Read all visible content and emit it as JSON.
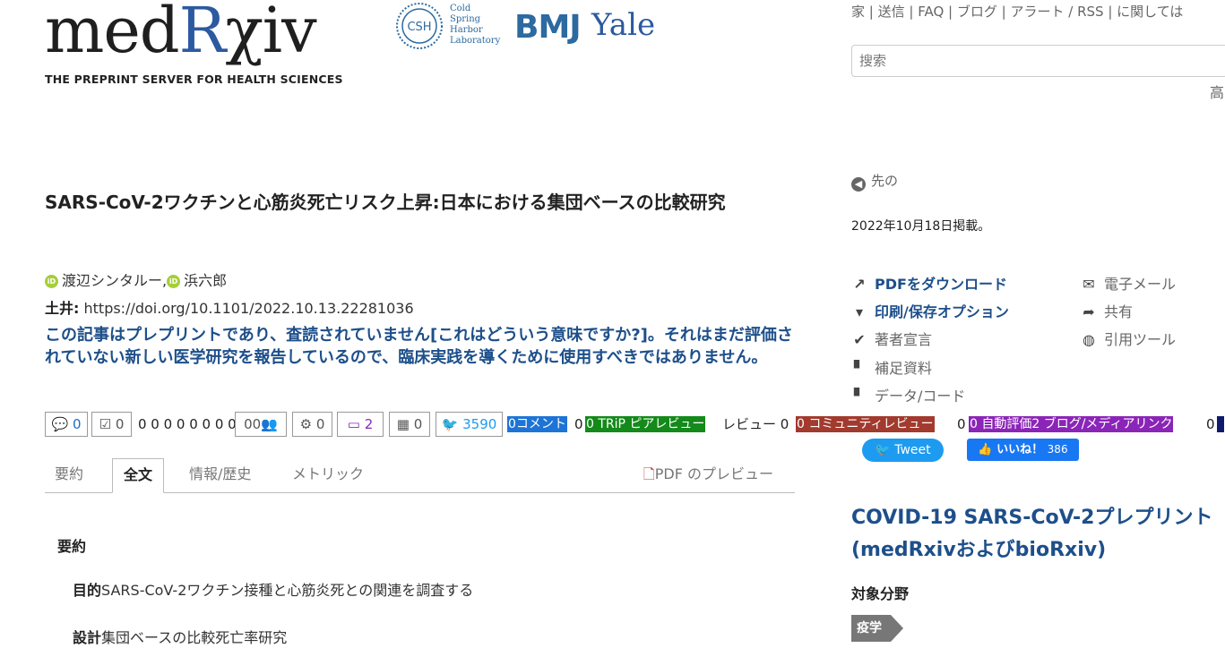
{
  "header": {
    "logo_main": "med",
    "logo_r": "R",
    "logo_rest": "χiv",
    "tagline": "THE PREPRINT SERVER FOR HEALTH SCIENCES",
    "csh_label": "CSH",
    "csh_text": [
      "Cold",
      "Spring",
      "Harbor",
      "Laboratory"
    ],
    "bmj": "BMJ",
    "yale": "Yale",
    "nav": [
      "家",
      "送信",
      "FAQ",
      "ブログ",
      "アラート / RSS",
      "に関しては"
    ],
    "search_placeholder": "搜索",
    "advanced": "高"
  },
  "article": {
    "title": "SARS-CoV-2ワクチンと心筋炎死亡リスク上昇:日本における集団ベースの比較研究",
    "authors": [
      "渡辺シンタルー,",
      "浜六郎"
    ],
    "doi_label": "土井:",
    "doi": "https://doi.org/10.1101/2022.10.13.22281036",
    "warning": "この記事はプレプリントであり、査読されていません[これはどういう意味ですか?]。それはまだ評価されていない新しい医学研究を報告しているので、臨床実践を導くために使用すべきではありません。"
  },
  "metrics": {
    "comments": "0",
    "checks": "0",
    "zeros_text": "0 0 0 0 0 0 0 0",
    "people": "00",
    "gears": "0",
    "monitor": "2",
    "film": "0",
    "twitter": "3590",
    "tag_comment": "0コメント",
    "sep1": "0",
    "tag_trip": "0 TRiP ピアレビュー",
    "review_text": "レビュー 0",
    "tag_community": "0 コミュニティレビュー",
    "sep2": "0",
    "tag_auto": "0 自動評価2 ブログ/メディアリンク",
    "sep3": "0"
  },
  "tabs": {
    "abstract": "要約",
    "fulltext": "全文",
    "info": "情報/歴史",
    "metrics": "メトリック",
    "pdf_preview": "PDF のプレビュー"
  },
  "abstract": {
    "heading": "要約",
    "objective_label": "目的",
    "objective": "SARS-CoV-2ワクチン接種と心筋炎死との関連を調査する",
    "design_label": "設計",
    "design": "集団ベースの比較死亡率研究"
  },
  "sidebar": {
    "previous": "先の",
    "posted": "2022年10月18日掲載。",
    "download_pdf": "PDFをダウンロード",
    "print_options": "印刷/保存オプション",
    "author_declarations": "著者宣言",
    "supplementary": "補足資料",
    "data_code": "データ/コード",
    "email": "電子メール",
    "share": "共有",
    "citation_tools": "引用ツール",
    "tweet": "Tweet",
    "like": "いいね！",
    "like_count": "386",
    "covid_link": "COVID-19 SARS-CoV-2プレプリント (medRxivおよびbioRxiv)",
    "subject_heading": "対象分野",
    "subject": "疫学"
  }
}
